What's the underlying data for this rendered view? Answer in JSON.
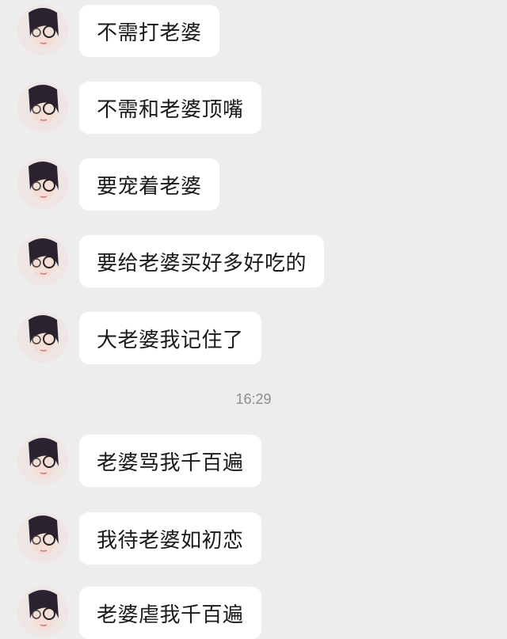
{
  "conversation": {
    "messages": [
      {
        "text": "不需打老婆"
      },
      {
        "text": "不需和老婆顶嘴"
      },
      {
        "text": "要宠着老婆"
      },
      {
        "text": "要给老婆买好多好吃的"
      },
      {
        "text": "大老婆我记住了"
      },
      {
        "text": "老婆骂我千百遍"
      },
      {
        "text": "我待老婆如初恋"
      },
      {
        "text": "老婆虐我千百遍"
      }
    ],
    "timestamp": "16:29"
  },
  "colors": {
    "background": "#ededed",
    "bubble": "#ffffff",
    "text": "#1a1a1a",
    "timestamp": "#8c8c8c"
  }
}
